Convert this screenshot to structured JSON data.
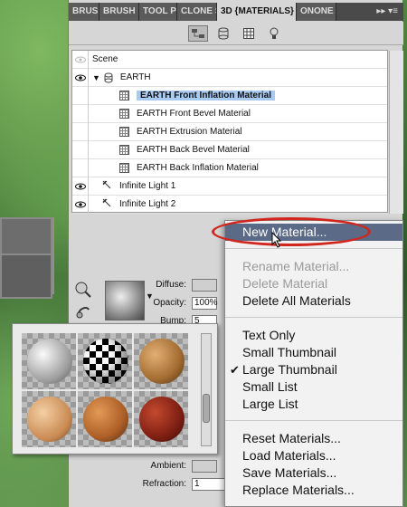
{
  "tabs": [
    "BRUSH",
    "BRUSH P",
    "TOOL P",
    "CLONE S",
    "3D {MATERIALS}",
    "ONONE"
  ],
  "tab_controls": "▸▸  ▾≡",
  "tree": {
    "scene_label": "Scene",
    "items": [
      {
        "label": "EARTH",
        "type": "mesh"
      },
      {
        "label": "EARTH Front Inflation Material",
        "type": "material",
        "selected": true
      },
      {
        "label": "EARTH Front Bevel Material",
        "type": "material"
      },
      {
        "label": "EARTH Extrusion Material",
        "type": "material"
      },
      {
        "label": "EARTH Back Bevel Material",
        "type": "material"
      },
      {
        "label": "EARTH Back Inflation Material",
        "type": "material"
      },
      {
        "label": "Infinite Light 1",
        "type": "light"
      },
      {
        "label": "Infinite Light 2",
        "type": "light"
      }
    ]
  },
  "props": {
    "diffuse_label": "Diffuse:",
    "opacity_label": "Opacity:",
    "opacity_value": "100%",
    "bump_label": "Bump:",
    "bump_value": "5",
    "ambient_label": "Ambient:",
    "refraction_label": "Refraction:",
    "refraction_value": "1"
  },
  "picker": {
    "materials": [
      {
        "name": "plaster",
        "color": "#bdbdbd"
      },
      {
        "name": "checker",
        "color": "#000000"
      },
      {
        "name": "cork",
        "color": "#b07a3c"
      },
      {
        "name": "peach",
        "color": "#d9a06a"
      },
      {
        "name": "rust-wood",
        "color": "#b8642c"
      },
      {
        "name": "red-leather",
        "color": "#8e2418"
      }
    ]
  },
  "menu": {
    "items": [
      {
        "label": "New Material...",
        "state": "highlighted"
      },
      {
        "label": "Rename Material...",
        "state": "disabled"
      },
      {
        "label": "Delete Material",
        "state": "disabled"
      },
      {
        "label": "Delete All Materials",
        "state": "normal"
      },
      {
        "label": "Text Only",
        "state": "normal"
      },
      {
        "label": "Small Thumbnail",
        "state": "normal"
      },
      {
        "label": "Large Thumbnail",
        "state": "checked"
      },
      {
        "label": "Small List",
        "state": "normal"
      },
      {
        "label": "Large List",
        "state": "normal"
      },
      {
        "label": "Reset Materials...",
        "state": "normal"
      },
      {
        "label": "Load Materials...",
        "state": "normal"
      },
      {
        "label": "Save Materials...",
        "state": "normal"
      },
      {
        "label": "Replace Materials...",
        "state": "normal"
      }
    ],
    "check_mark": "✔"
  },
  "colors": {
    "highlight": "#5b6a86",
    "selection": "#a9cbf2",
    "annotation": "#d0261d"
  }
}
